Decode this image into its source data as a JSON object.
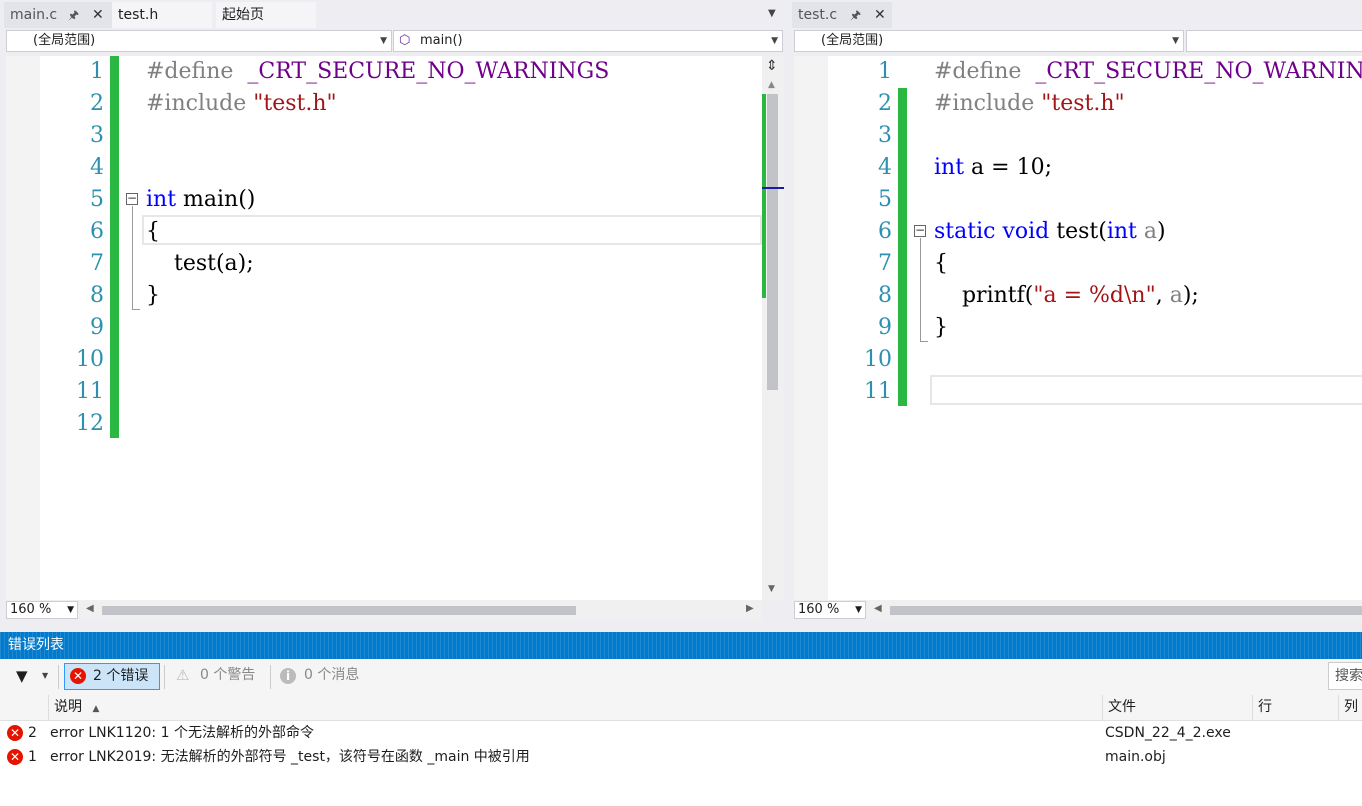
{
  "left_pane": {
    "tabs": [
      {
        "label": "main.c",
        "pinned": true
      },
      {
        "label": "test.h"
      },
      {
        "label": "起始页"
      }
    ],
    "scope_combo": "(全局范围)",
    "member_combo": "main()",
    "line_numbers": [
      "1",
      "2",
      "3",
      "4",
      "5",
      "6",
      "7",
      "8",
      "9",
      "10",
      "11",
      "12"
    ],
    "code": {
      "l1_directive": "#define",
      "l1_macro": "_CRT_SECURE_NO_WARNINGS",
      "l2_directive": "#include",
      "l2_string": "\"test.h\"",
      "l5_kw": "int",
      "l5_rest": " main()",
      "l6": "{",
      "l7": "    test(a);",
      "l8": "}"
    },
    "zoom": "160 %"
  },
  "right_pane": {
    "tabs": [
      {
        "label": "test.c",
        "pinned": true
      }
    ],
    "scope_combo": "(全局范围)",
    "line_numbers": [
      "1",
      "2",
      "3",
      "4",
      "5",
      "6",
      "7",
      "8",
      "9",
      "10",
      "11"
    ],
    "code": {
      "l1_directive": "#define",
      "l1_macro": "_CRT_SECURE_NO_WARNINGS",
      "l2_directive": "#include",
      "l2_string": "\"test.h\"",
      "l4_kw": "int",
      "l4_rest": " a = 10;",
      "l6_kw1": "static",
      "l6_kw2": "void",
      "l6_name": " test(",
      "l6_kw3": "int",
      "l6_param": " a",
      "l6_close": ")",
      "l7": "{",
      "l8_call": "    printf(",
      "l8_string": "\"a = %d\\n\"",
      "l8_rest": ", ",
      "l8_arg": "a",
      "l8_end": ");",
      "l9": "}"
    },
    "zoom": "160 %"
  },
  "error_list": {
    "title": "错误列表",
    "errors_button": "2 个错误",
    "warnings_button": "0 个警告",
    "messages_button": "0 个消息",
    "search_label": "搜索",
    "columns": {
      "description": "说明",
      "file": "文件",
      "line": "行",
      "column": "列"
    },
    "rows": [
      {
        "code": "2",
        "description": "error LNK1120: 1 个无法解析的外部命令",
        "file": "CSDN_22_4_2.exe"
      },
      {
        "code": "1",
        "description": "error LNK2019: 无法解析的外部符号 _test，该符号在函数 _main 中被引用",
        "file": "main.obj"
      }
    ]
  },
  "colors": {
    "accent": "#007acc",
    "change_bar": "#2ab742",
    "keyword": "#0000ff",
    "macro": "#6f008a",
    "string": "#a31515",
    "line_number": "#2b91af",
    "error": "#e51400"
  }
}
